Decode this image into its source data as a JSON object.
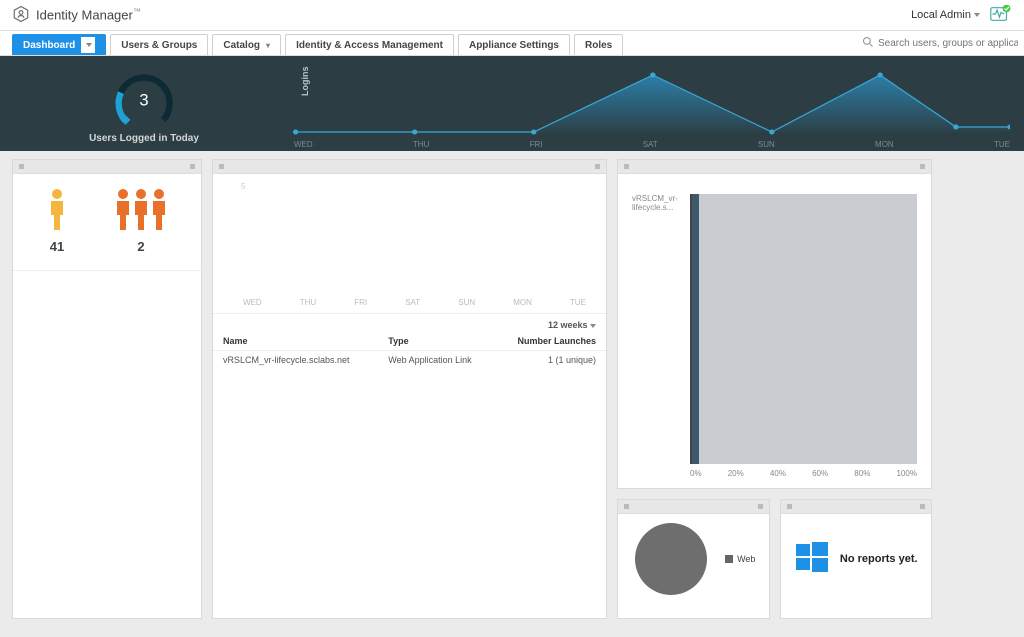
{
  "brand": "Identity Manager",
  "user_label": "Local Admin",
  "search": {
    "placeholder": "Search users, groups or applications"
  },
  "nav": {
    "tabs": [
      {
        "label": "Dashboard",
        "has_caret": true,
        "active": true
      },
      {
        "label": "Users & Groups"
      },
      {
        "label": "Catalog",
        "has_caret": true
      },
      {
        "label": "Identity & Access Management"
      },
      {
        "label": "Appliance Settings"
      },
      {
        "label": "Roles"
      }
    ]
  },
  "hero": {
    "gauge_value": "3",
    "gauge_label": "Users Logged in Today",
    "y_label": "Logins",
    "days": [
      "WED",
      "THU",
      "FRI",
      "SAT",
      "SUN",
      "MON",
      "TUE"
    ]
  },
  "users_card": {
    "single_count": "41",
    "group_count": "2"
  },
  "apps_card": {
    "range_label": "12 weeks",
    "mini_x": [
      "WED",
      "THU",
      "FRI",
      "SAT",
      "SUN",
      "MON",
      "TUE"
    ],
    "cols": {
      "name": "Name",
      "type": "Type",
      "launches": "Number Launches"
    },
    "rows": [
      {
        "name": "vRSLCM_vr-lifecycle.sclabs.net",
        "type": "Web Application Link",
        "launches": "1 (1 unique)"
      }
    ]
  },
  "bar_card": {
    "label": "vRSLCM_vr-lifecycle.s...",
    "ticks": [
      "0%",
      "20%",
      "40%",
      "60%",
      "80%",
      "100%"
    ],
    "fill_pct": 3
  },
  "pie_card": {
    "legend": "Web"
  },
  "reports_card": {
    "text": "No reports yet."
  },
  "chart_data": {
    "type": "line",
    "title": "Logins",
    "categories": [
      "WED",
      "THU",
      "FRI",
      "SAT",
      "SUN",
      "MON",
      "TUE"
    ],
    "values": [
      0,
      0,
      0,
      10,
      0,
      10,
      1
    ],
    "ylabel": "Logins",
    "ylim": [
      0,
      10
    ]
  }
}
